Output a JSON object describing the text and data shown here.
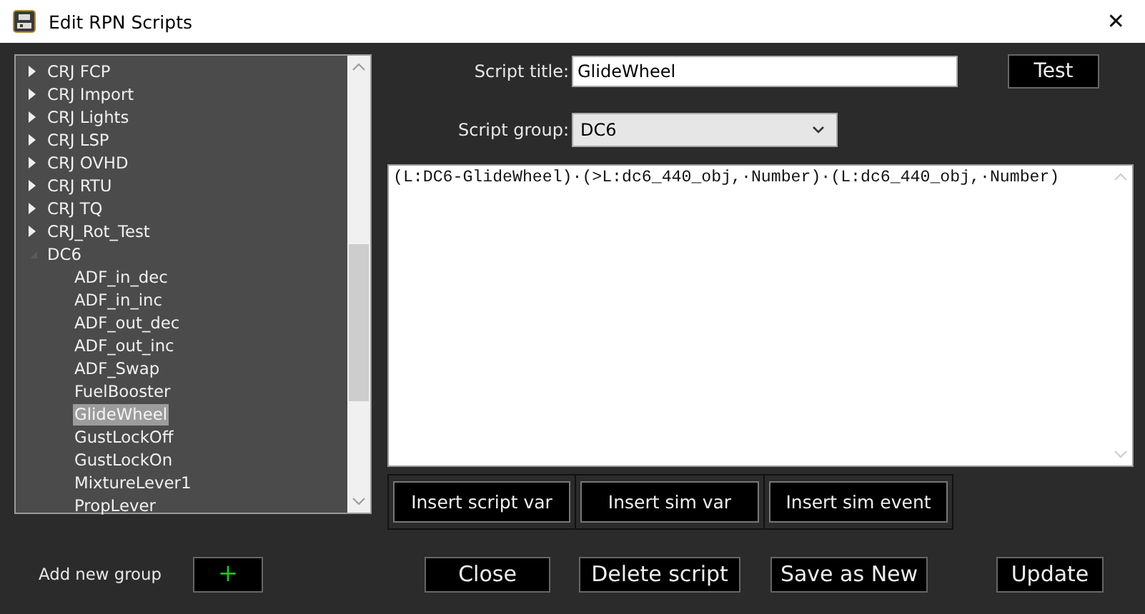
{
  "window": {
    "title": "Edit RPN Scripts",
    "close": "✕"
  },
  "tree": [
    {
      "label": "CRJ FCP",
      "expanded": false,
      "selected": false
    },
    {
      "label": "CRJ Import",
      "expanded": false,
      "selected": false
    },
    {
      "label": "CRJ Lights",
      "expanded": false,
      "selected": false
    },
    {
      "label": "CRJ LSP",
      "expanded": false,
      "selected": false
    },
    {
      "label": "CRJ OVHD",
      "expanded": false,
      "selected": false
    },
    {
      "label": "CRJ RTU",
      "expanded": false,
      "selected": false
    },
    {
      "label": "CRJ TQ",
      "expanded": false,
      "selected": false
    },
    {
      "label": "CRJ_Rot_Test",
      "expanded": false,
      "selected": false
    },
    {
      "label": "DC6",
      "expanded": true,
      "selected": false,
      "children": [
        {
          "label": "ADF_in_dec",
          "selected": false
        },
        {
          "label": "ADF_in_inc",
          "selected": false
        },
        {
          "label": "ADF_out_dec",
          "selected": false
        },
        {
          "label": "ADF_out_inc",
          "selected": false
        },
        {
          "label": "ADF_Swap",
          "selected": false
        },
        {
          "label": "FuelBooster",
          "selected": false
        },
        {
          "label": "GlideWheel",
          "selected": true
        },
        {
          "label": "GustLockOff",
          "selected": false
        },
        {
          "label": "GustLockOn",
          "selected": false
        },
        {
          "label": "MixtureLever1",
          "selected": false
        },
        {
          "label": "PropLever",
          "selected": false
        }
      ]
    }
  ],
  "form": {
    "title_label": "Script title:",
    "title_value": "GlideWheel",
    "test_button": "Test",
    "group_label": "Script group:",
    "group_value": "DC6",
    "script": "(L:DC6-GlideWheel)·(>L:dc6_440_obj,·Number)·(L:dc6_440_obj,·Number)"
  },
  "insert_buttons": [
    "Insert script var",
    "Insert sim var",
    "Insert sim event"
  ],
  "add_group": {
    "label": "Add new group",
    "button": "+"
  },
  "buttons": [
    "Close",
    "Delete script",
    "Save as New",
    "Update"
  ]
}
